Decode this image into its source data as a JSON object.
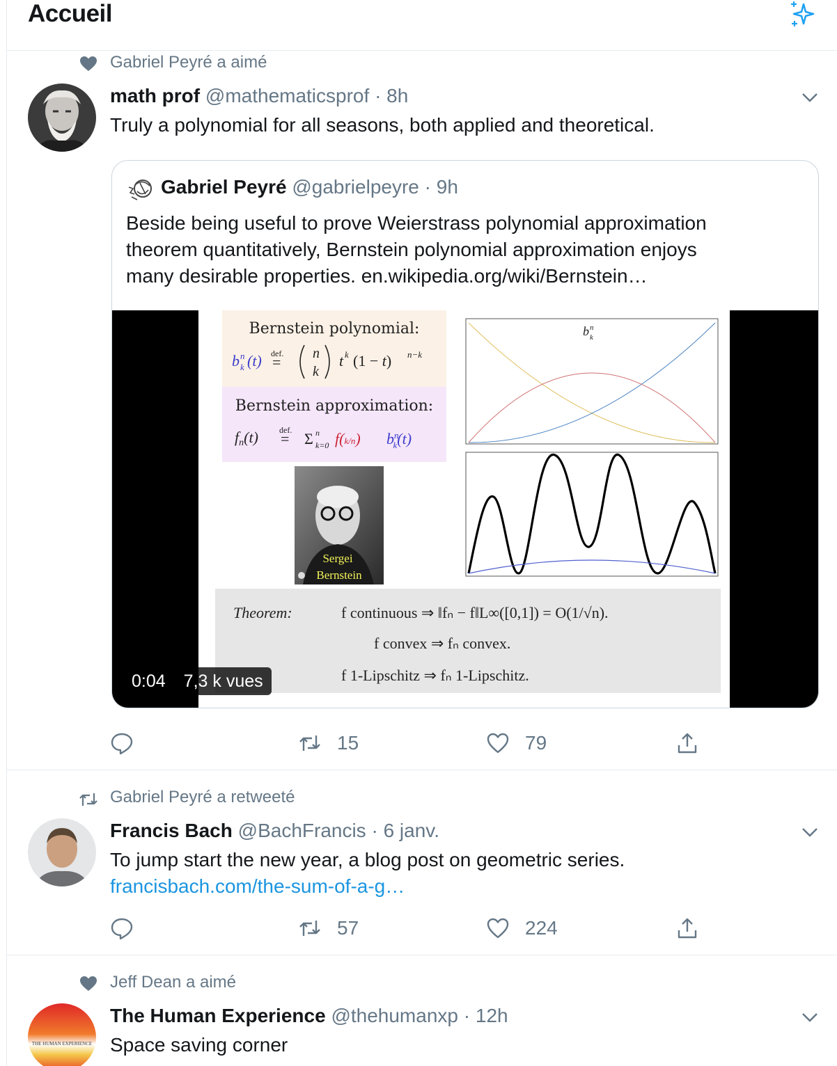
{
  "header": {
    "title": "Accueil",
    "sparkle_icon": "sparkle-icon"
  },
  "tweets": [
    {
      "social_context": "Gabriel Peyré a aimé",
      "social_icon": "heart-filled-icon",
      "name": "math prof",
      "handle": "@mathematicsprof",
      "time": "· 8h",
      "text": "Truly a polynomial for all seasons, both applied and theoretical.",
      "quote": {
        "name": "Gabriel Peyré",
        "handle": "@gabrielpeyre",
        "time": "· 9h",
        "lines": [
          "Beside being useful to prove Weierstrass polynomial approximation",
          "theorem quantitatively, Bernstein polynomial approximation enjoys",
          "many desirable properties. en.wikipedia.org/wiki/Bernstein…"
        ],
        "video": {
          "duration": "0:04",
          "views": "7,3 k vues",
          "slide": {
            "poly_title": "Bernstein polynomial:",
            "poly_def": "def.",
            "approx_title": "Bernstein approximation:",
            "approx_def": "def.",
            "plot_label": "b",
            "photo_caption_1": "Sergei",
            "photo_caption_2": "Bernstein",
            "theorem_label": "Theorem:",
            "theorem_line_1": "f continuous ⇒ ‖fₙ − f‖L∞([0,1]) = O(1/√n).",
            "theorem_line_2": "f convex ⇒ fₙ convex.",
            "theorem_line_3": "f 1-Lipschitz ⇒ fₙ 1-Lipschitz."
          }
        }
      },
      "replies": "",
      "retweets": "15",
      "likes": "79"
    },
    {
      "social_context": "Gabriel Peyré a retweeté",
      "social_icon": "retweet-icon",
      "name": "Francis Bach",
      "handle": "@BachFrancis",
      "time": "· 6 janv.",
      "text": "To jump start the new year, a blog post on geometric series.",
      "link": "francisbach.com/the-sum-of-a-g…",
      "replies": "",
      "retweets": "57",
      "likes": "224"
    },
    {
      "social_context": "Jeff Dean a aimé",
      "social_icon": "heart-filled-icon",
      "name": "The Human Experience",
      "handle": "@thehumanxp",
      "time": "· 12h",
      "text": "Space saving corner",
      "avatar_text": "THE HUMAN EXPERIENCE"
    }
  ],
  "colors": {
    "text": "#14171a",
    "secondary": "#657786",
    "link": "#1b95e0",
    "border": "#e6ecf0"
  }
}
